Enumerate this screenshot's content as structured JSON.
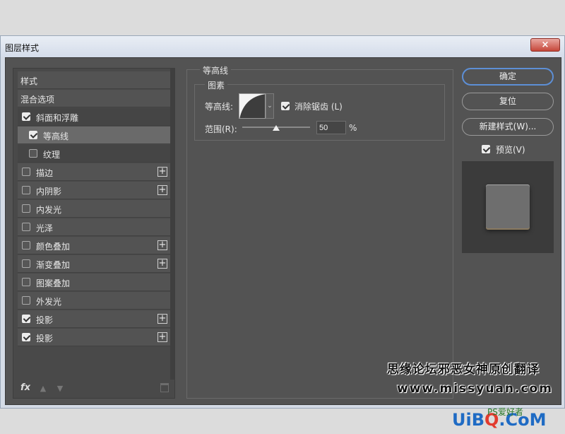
{
  "window": {
    "title": "图层样式",
    "close_label": "×"
  },
  "styles_list": {
    "items": [
      {
        "label": "样式",
        "checkbox": null,
        "checked": false,
        "plus": false,
        "indent": false,
        "state": "normal"
      },
      {
        "label": "混合选项",
        "checkbox": null,
        "checked": false,
        "plus": false,
        "indent": false,
        "state": "normal"
      },
      {
        "label": "斜面和浮雕",
        "checkbox": true,
        "checked": true,
        "plus": false,
        "indent": false,
        "state": "dark"
      },
      {
        "label": "等高线",
        "checkbox": true,
        "checked": true,
        "plus": false,
        "indent": true,
        "state": "selected"
      },
      {
        "label": "纹理",
        "checkbox": true,
        "checked": false,
        "plus": false,
        "indent": true,
        "state": "dark"
      },
      {
        "label": "描边",
        "checkbox": true,
        "checked": false,
        "plus": true,
        "indent": false,
        "state": "normal"
      },
      {
        "label": "内阴影",
        "checkbox": true,
        "checked": false,
        "plus": true,
        "indent": false,
        "state": "normal"
      },
      {
        "label": "内发光",
        "checkbox": true,
        "checked": false,
        "plus": false,
        "indent": false,
        "state": "normal"
      },
      {
        "label": "光泽",
        "checkbox": true,
        "checked": false,
        "plus": false,
        "indent": false,
        "state": "normal"
      },
      {
        "label": "颜色叠加",
        "checkbox": true,
        "checked": false,
        "plus": true,
        "indent": false,
        "state": "normal"
      },
      {
        "label": "渐变叠加",
        "checkbox": true,
        "checked": false,
        "plus": true,
        "indent": false,
        "state": "normal"
      },
      {
        "label": "图案叠加",
        "checkbox": true,
        "checked": false,
        "plus": false,
        "indent": false,
        "state": "normal"
      },
      {
        "label": "外发光",
        "checkbox": true,
        "checked": false,
        "plus": false,
        "indent": false,
        "state": "normal"
      },
      {
        "label": "投影",
        "checkbox": true,
        "checked": true,
        "plus": true,
        "indent": false,
        "state": "normal"
      },
      {
        "label": "投影",
        "checkbox": true,
        "checked": true,
        "plus": true,
        "indent": false,
        "state": "normal"
      }
    ],
    "toolbar": {
      "fx_label": "fx",
      "up_icon": "arrow-up-icon",
      "down_icon": "arrow-down-icon",
      "trash_icon": "trash-icon"
    }
  },
  "contour_panel": {
    "group_title": "等高线",
    "sub_title": "图素",
    "contour_label": "等高线:",
    "antialias_label": "消除锯齿 (L)",
    "antialias_checked": true,
    "range_label": "范围(R):",
    "range_value": "50",
    "range_percent": 50,
    "range_unit": "%"
  },
  "buttons": {
    "ok": "确定",
    "reset": "复位",
    "new_style": "新建样式(W)..."
  },
  "preview": {
    "label": "预览(V)",
    "checked": true
  },
  "watermarks": {
    "line1": "思缘论坛邪恶女神原创翻译",
    "line2": "www.missyuan.com",
    "logo_a": "UiB",
    "logo_b": "Q",
    "logo_c": ".CoM",
    "logo_small": "PS爱好者"
  },
  "colors": {
    "dialog_bg": "#535353",
    "primary_border": "#5d8fd6"
  }
}
